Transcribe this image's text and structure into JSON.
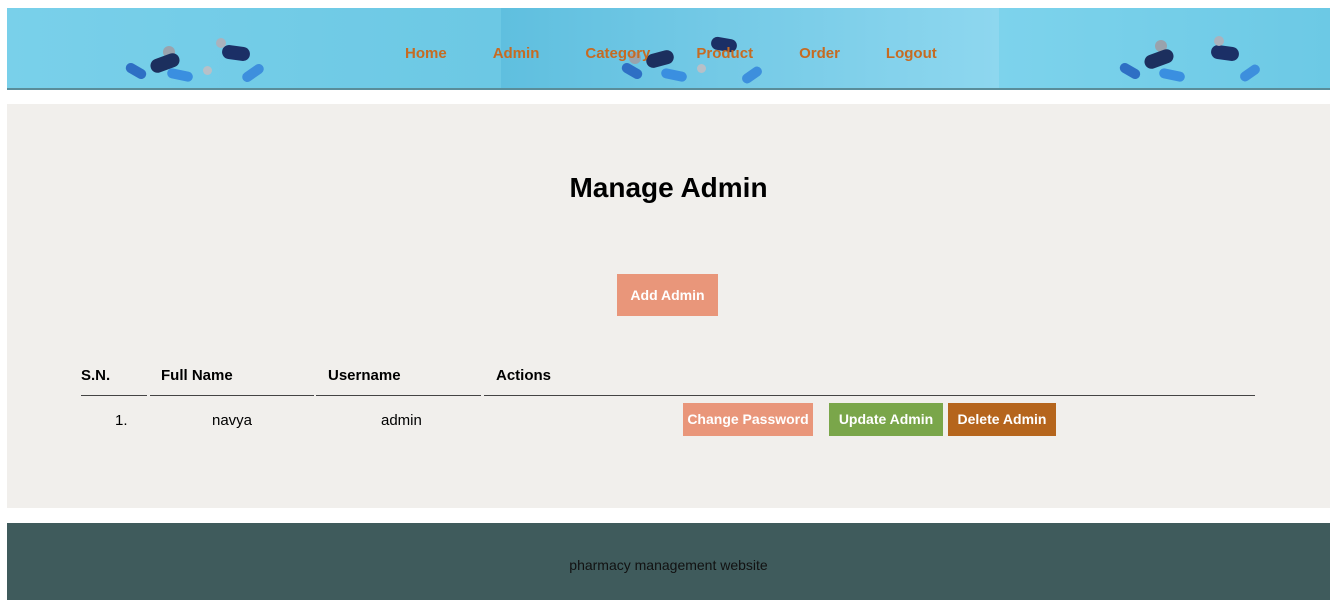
{
  "header": {
    "nav": [
      {
        "label": "Home"
      },
      {
        "label": "Admin"
      },
      {
        "label": "Category"
      },
      {
        "label": "Product"
      },
      {
        "label": "Order"
      },
      {
        "label": "Logout"
      }
    ]
  },
  "main": {
    "title": "Manage Admin",
    "add_button": "Add Admin",
    "table": {
      "columns": [
        "S.N.",
        "Full Name",
        "Username",
        "Actions"
      ],
      "rows": [
        {
          "sn": "1.",
          "full_name": "navya",
          "username": "admin",
          "actions": {
            "change_password": "Change Password",
            "update": "Update Admin",
            "delete": "Delete Admin"
          }
        }
      ]
    }
  },
  "footer": {
    "text": "pharmacy management website"
  },
  "colors": {
    "nav_text": "#c66b22",
    "header_bg": "#72cde6",
    "main_bg": "#f1efec",
    "footer_bg": "#3f5b5c",
    "add_button": "#e9967a",
    "change_password_button": "#e9967a",
    "update_button": "#7aa64a",
    "delete_button": "#b5651d"
  }
}
